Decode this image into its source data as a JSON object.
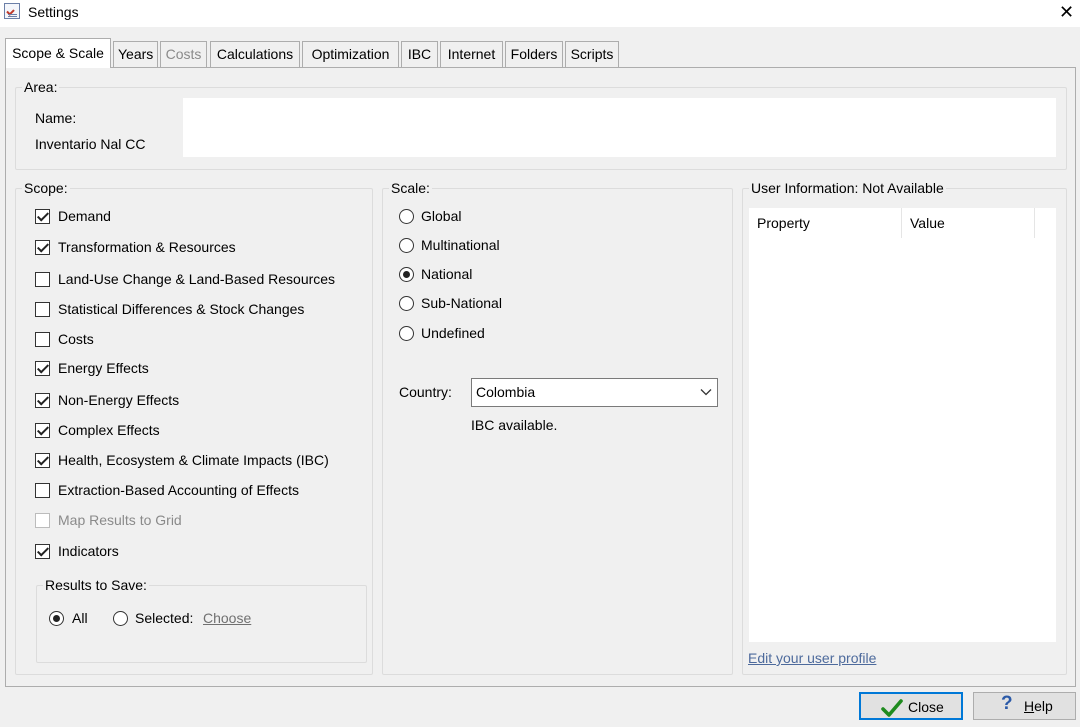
{
  "window": {
    "title": "Settings"
  },
  "tabs": [
    {
      "label": "Scope & Scale",
      "active": true,
      "enabled": true
    },
    {
      "label": "Years",
      "active": false,
      "enabled": true
    },
    {
      "label": "Costs",
      "active": false,
      "enabled": false
    },
    {
      "label": "Calculations",
      "active": false,
      "enabled": true
    },
    {
      "label": "Optimization",
      "active": false,
      "enabled": true
    },
    {
      "label": "IBC",
      "active": false,
      "enabled": true
    },
    {
      "label": "Internet",
      "active": false,
      "enabled": true
    },
    {
      "label": "Folders",
      "active": false,
      "enabled": true
    },
    {
      "label": "Scripts",
      "active": false,
      "enabled": true
    }
  ],
  "area": {
    "title": "Area:",
    "name_label": "Name:",
    "name_value": "Inventario Nal CC"
  },
  "scope": {
    "title": "Scope:",
    "items": [
      {
        "label": "Demand",
        "checked": true,
        "enabled": true
      },
      {
        "label": "Transformation & Resources",
        "checked": true,
        "enabled": true
      },
      {
        "label": "Land-Use Change & Land-Based Resources",
        "checked": false,
        "enabled": true
      },
      {
        "label": "Statistical Differences & Stock Changes",
        "checked": false,
        "enabled": true
      },
      {
        "label": "Costs",
        "checked": false,
        "enabled": true
      },
      {
        "label": "Energy Effects",
        "checked": true,
        "enabled": true
      },
      {
        "label": "Non-Energy Effects",
        "checked": true,
        "enabled": true
      },
      {
        "label": "Complex Effects",
        "checked": true,
        "enabled": true
      },
      {
        "label": "Health, Ecosystem & Climate Impacts (IBC)",
        "checked": true,
        "enabled": true
      },
      {
        "label": "Extraction-Based Accounting of Effects",
        "checked": false,
        "enabled": true
      },
      {
        "label": "Map Results to Grid",
        "checked": false,
        "enabled": false
      },
      {
        "label": "Indicators",
        "checked": true,
        "enabled": true
      }
    ],
    "results_to_save": {
      "title": "Results to Save:",
      "all_label": "All",
      "selected_label": "Selected:",
      "choose_link": "Choose",
      "selection": "All"
    }
  },
  "scale": {
    "title": "Scale:",
    "options": [
      "Global",
      "Multinational",
      "National",
      "Sub-National",
      "Undefined"
    ],
    "selected": "National",
    "country_label": "Country:",
    "country_value": "Colombia",
    "ibc_status": "IBC available."
  },
  "user_info": {
    "title": "User Information: Not Available",
    "columns": [
      "Property",
      "Value"
    ],
    "edit_link": "Edit your user profile"
  },
  "buttons": {
    "close_label": "Close",
    "help_label": "Help",
    "help_mnemonic": "H",
    "help_rest": "elp"
  },
  "colors": {
    "accent": "#0078d7",
    "link": "#4d6a9c",
    "close_check": "#1f8b1f",
    "help_icon": "#2b5aa8"
  },
  "icons": {
    "app": "settings-checklist-icon",
    "close": "close-icon",
    "dropdown": "chevron-down-icon",
    "close_button": "checkmark-icon",
    "help_button": "question-mark-icon"
  }
}
